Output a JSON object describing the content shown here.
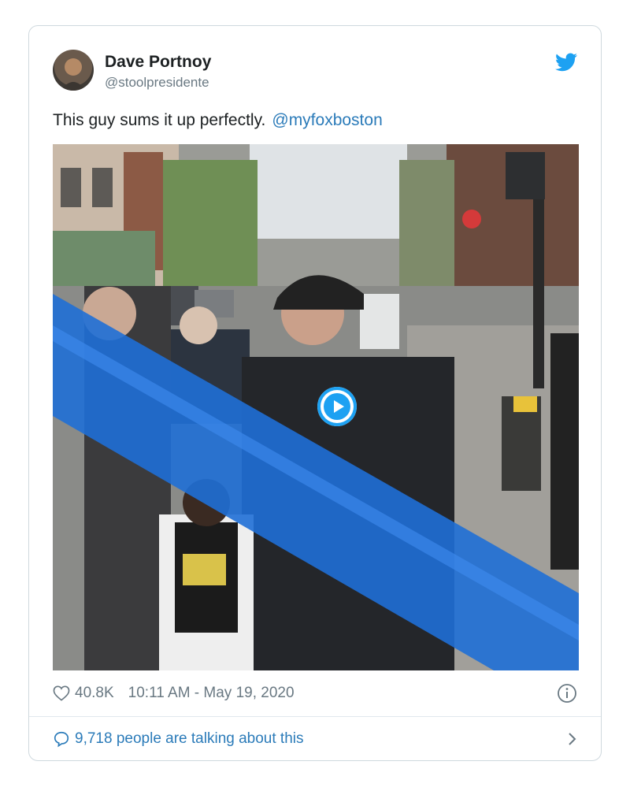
{
  "tweet": {
    "author_name": "Dave Portnoy",
    "author_handle": "@stoolpresidente",
    "text": "This guy sums it up perfectly.",
    "mention": "@myfoxboston",
    "likes": "40.8K",
    "timestamp": "10:11 AM - May 19, 2020",
    "talking": "9,718 people are talking about this"
  },
  "icons": {
    "brand": "twitter-bird-icon",
    "like": "heart-icon",
    "info": "info-icon",
    "reply": "speech-bubble-icon",
    "play": "play-icon",
    "chevron": "chevron-right-icon"
  },
  "colors": {
    "brand": "#1da1f2",
    "link": "#2b7bb9",
    "secondary_text": "#697882",
    "tape": "#1f6fd6"
  }
}
